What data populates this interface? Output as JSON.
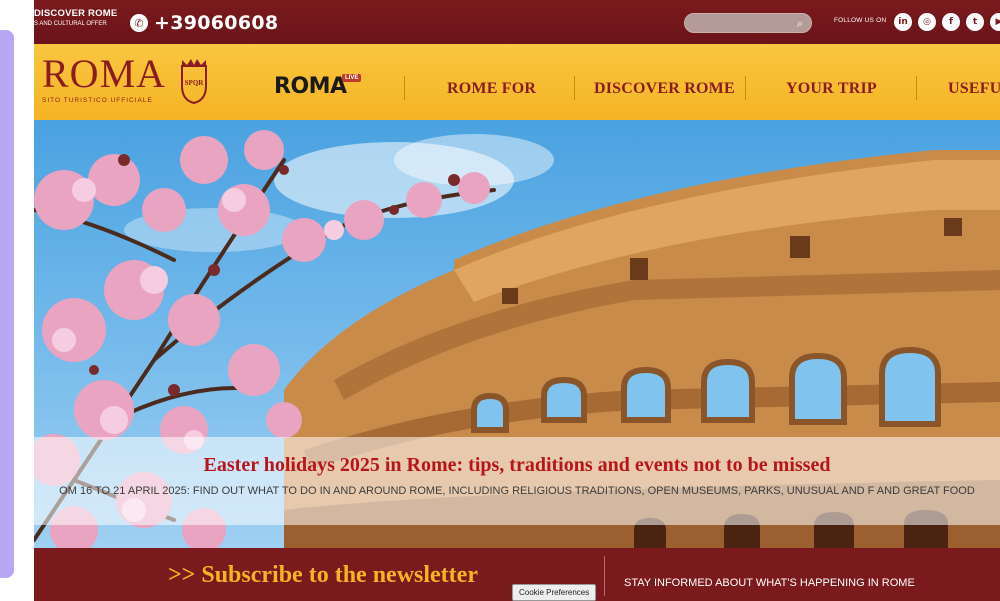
{
  "topbar": {
    "brand_line1": "DISCOVER ROME",
    "brand_line2": "S AND CULTURAL OFFER",
    "phone": "+39060608",
    "search_placeholder": "",
    "follow_label": "FOLLOW US ON",
    "socials": [
      "in",
      "◎",
      "f",
      "t",
      "▶"
    ]
  },
  "nav": {
    "logo_text": "ROMA",
    "logo_subtitle": "SITO TURISTICO UFFICIALE",
    "crest_text": "SPQR",
    "roma_live": "ROMA",
    "live_badge": "LIVE",
    "menu": [
      "ROME FOR",
      "DISCOVER ROME",
      "YOUR TRIP",
      "USEFU"
    ]
  },
  "hero": {
    "title": "Easter holidays 2025 in Rome: tips, traditions and events not to be missed",
    "subtitle": "OM 16 TO 21 APRIL 2025: FIND OUT WHAT TO DO IN AND AROUND ROME, INCLUDING RELIGIOUS TRADITIONS, OPEN MUSEUMS, PARKS, UNUSUAL AND F AND GREAT FOOD"
  },
  "newsletter": {
    "cta": ">> Subscribe to the newsletter",
    "info": "STAY INFORMED ABOUT WHAT'S HAPPENING IN ROME"
  },
  "cookie": {
    "label": "Cookie Preferences"
  },
  "colors": {
    "maroon": "#7a1a1d",
    "gold": "#f5b424",
    "red_title": "#b8141a"
  }
}
